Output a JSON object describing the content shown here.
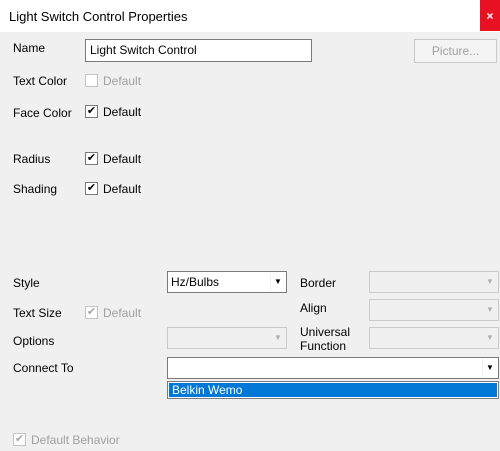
{
  "window": {
    "title": "Light Switch Control Properties",
    "close_glyph": "×"
  },
  "name": {
    "label": "Name",
    "value": "Light Switch Control"
  },
  "picture_button": {
    "label": "Picture..."
  },
  "text_color": {
    "label": "Text Color",
    "default_label": "Default",
    "checked": false
  },
  "face_color": {
    "label": "Face Color",
    "default_label": "Default",
    "checked": true
  },
  "radius": {
    "label": "Radius",
    "default_label": "Default",
    "checked": true
  },
  "shading": {
    "label": "Shading",
    "default_label": "Default",
    "checked": true
  },
  "style": {
    "label": "Style",
    "value": "Hz/Bulbs"
  },
  "border": {
    "label": "Border",
    "value": ""
  },
  "text_size": {
    "label": "Text Size",
    "default_label": "Default",
    "checked": true
  },
  "align": {
    "label": "Align",
    "value": ""
  },
  "options": {
    "label": "Options",
    "value": ""
  },
  "universal_function": {
    "label_line1": "Universal",
    "label_line2": "Function",
    "value": ""
  },
  "connect_to": {
    "label": "Connect To",
    "value": "",
    "list_items": [
      "Belkin Wemo"
    ]
  },
  "default_behavior": {
    "label": "Default Behavior",
    "checked": true
  },
  "glyphs": {
    "check": "✔",
    "arrow_down": "▼"
  }
}
